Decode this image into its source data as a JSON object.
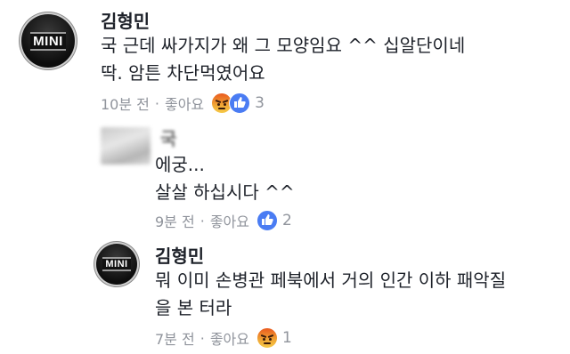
{
  "comments": [
    {
      "author": "김형민",
      "avatar_label": "MINI",
      "lines": [
        "국  근데 싸가지가 왜 그 모양임요 ^^ 십알단이네",
        "딱.  암튼 차단먹였어요"
      ],
      "time": "10분 전",
      "like_label": "좋아요",
      "reaction_count": "3"
    },
    {
      "author": "국",
      "lines": [
        "에궁...",
        "살살 하십시다 ^^"
      ],
      "time": "9분 전",
      "like_label": "좋아요",
      "reaction_count": "2"
    },
    {
      "author": "김형민",
      "avatar_label": "MINI",
      "lines": [
        "뭐 이미 손병관 페북에서 거의 인간 이하 패악질",
        "을 본 터라"
      ],
      "time": "7분 전",
      "like_label": "좋아요",
      "reaction_count": "1"
    }
  ],
  "separator": "·",
  "colors": {
    "meta": "#90949c",
    "like_blue": "#4a7cf3",
    "angry_orange": "#ea5a1f"
  },
  "icons": {
    "like": "thumbs-up-icon",
    "angry": "angry-face-icon"
  }
}
